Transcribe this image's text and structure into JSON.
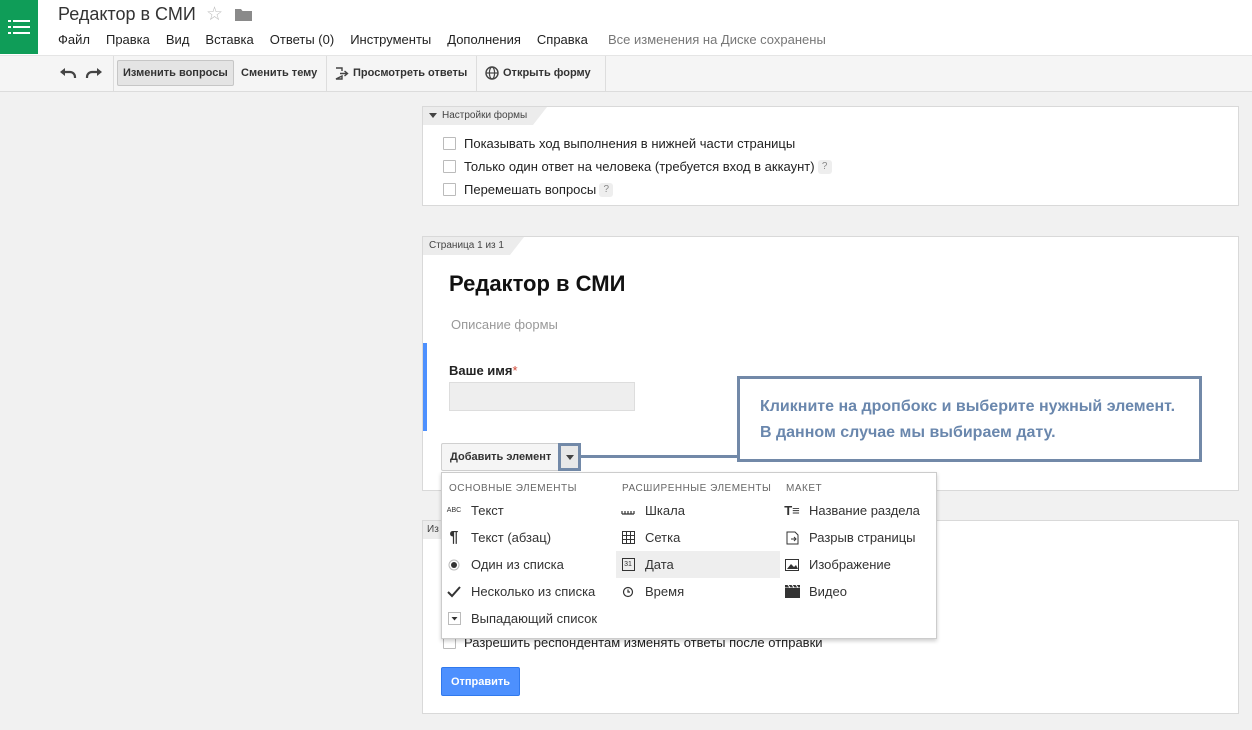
{
  "header": {
    "title": "Редактор в СМИ",
    "menu": [
      "Файл",
      "Правка",
      "Вид",
      "Вставка",
      "Ответы (0)",
      "Инструменты",
      "Дополнения",
      "Справка"
    ],
    "save_status": "Все изменения на Диске сохранены",
    "brand_color": "#0f9d58"
  },
  "toolbar": {
    "edit_questions": "Изменить вопросы",
    "change_theme": "Сменить тему",
    "view_responses": "Просмотреть ответы",
    "open_form": "Открыть форму"
  },
  "settings": {
    "tab": "Настройки формы",
    "options": [
      "Показывать ход выполнения в нижней части страницы",
      "Только один ответ на человека (требуется вход в аккаунт)",
      "Перемешать вопросы"
    ],
    "help_glyph": "?"
  },
  "page": {
    "tab": "Страница 1 из 1",
    "title": "Редактор в СМИ",
    "description_placeholder": "Описание формы",
    "question_label": "Ваше имя",
    "required_mark": "*",
    "add_item": "Добавить элемент"
  },
  "annotation": {
    "text": "Кликните на дропбокс и выберите нужный элемент. В данном случае мы выбираем дату."
  },
  "dropdown": {
    "basic": {
      "header": "ОСНОВНЫЕ ЭЛЕМЕНТЫ",
      "items": [
        "Текст",
        "Текст (абзац)",
        "Один из списка",
        "Несколько из списка",
        "Выпадающий список"
      ]
    },
    "advanced": {
      "header": "РАСШИРЕННЫЕ ЭЛЕМЕНТЫ",
      "items": [
        "Шкала",
        "Сетка",
        "Дата",
        "Время"
      ]
    },
    "layout": {
      "header": "МАКЕТ",
      "items": [
        "Название раздела",
        "Разрыв страницы",
        "Изображение",
        "Видео"
      ]
    },
    "highlighted": "Дата"
  },
  "confirmation": {
    "tab": "Из",
    "allow_edit": "Разрешить респондентам изменять ответы после отправки",
    "submit": "Отправить"
  },
  "icons": {
    "abc_text": "ABC",
    "date_day": "31"
  },
  "colors": {
    "accent_blue": "#4d90fe",
    "annotation": "#6a87ad",
    "required": "#d14836"
  }
}
